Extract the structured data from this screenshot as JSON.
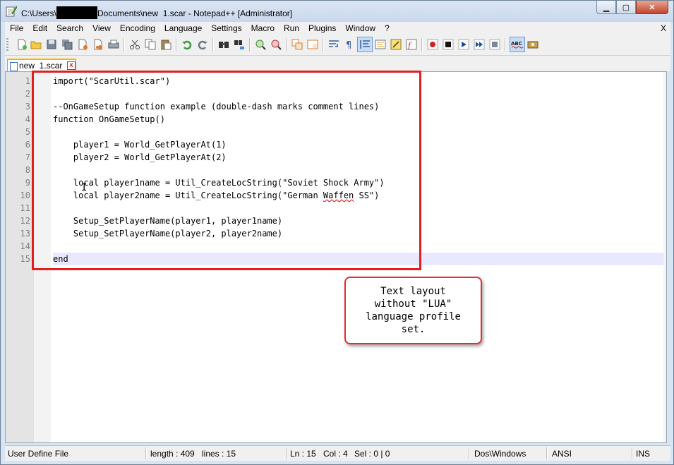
{
  "window": {
    "title_prefix": "C:\\Users\\",
    "title_suffix": "Documents\\new  1.scar - Notepad++ [Administrator]",
    "minimize_glyph": "▁",
    "maximize_glyph": "▢",
    "close_glyph": "✕"
  },
  "menu": {
    "items": [
      "File",
      "Edit",
      "Search",
      "View",
      "Encoding",
      "Language",
      "Settings",
      "Macro",
      "Run",
      "Plugins",
      "Window",
      "?"
    ],
    "close_label": "X"
  },
  "toolbar": {
    "icons": [
      "new-file-icon",
      "open-file-icon",
      "save-icon",
      "save-all-icon",
      "close-icon",
      "close-all-icon",
      "print-icon",
      "cut-icon",
      "copy-icon",
      "paste-icon",
      "undo-icon",
      "redo-icon",
      "find-icon",
      "replace-icon",
      "zoom-in-icon",
      "zoom-out-icon",
      "sync-vertical-icon",
      "sync-horizontal-icon",
      "word-wrap-icon",
      "show-all-chars-icon",
      "indent-guide-icon",
      "user-defined-lang-icon",
      "doc-map-icon",
      "function-list-icon",
      "record-macro-icon",
      "stop-record-icon",
      "play-macro-icon",
      "run-macro-multiple-icon",
      "save-macro-icon",
      "spell-check-icon",
      "settings-icon"
    ]
  },
  "tab": {
    "label": "new  1.scar",
    "close_glyph": "x"
  },
  "editor": {
    "lines": [
      "import(\"ScarUtil.scar\")",
      "",
      "--OnGameSetup function example (double-dash marks comment lines)",
      "function OnGameSetup()",
      "",
      "    player1 = World_GetPlayerAt(1)",
      "    player2 = World_GetPlayerAt(2)",
      "",
      "    local player1name = Util_CreateLocString(\"Soviet Shock Army\")",
      "    local player2name = Util_CreateLocString(\"German Waffen SS\")",
      "",
      "    Setup_SetPlayerName(player1, player1name)",
      "    Setup_SetPlayerName(player2, player2name)",
      "",
      "end"
    ],
    "line_numbers": [
      "1",
      "2",
      "3",
      "4",
      "5",
      "6",
      "7",
      "8",
      "9",
      "10",
      "11",
      "12",
      "13",
      "14",
      "15"
    ],
    "current_line": 15,
    "caret_glyph": "I"
  },
  "annotation": {
    "callout_text": "Text layout\nwithout \"LUA\"\nlanguage profile\nset."
  },
  "status": {
    "lang": "User Define File",
    "length": "length : 409",
    "lines": "lines : 15",
    "ln": "Ln : 15",
    "col": "Col : 4",
    "sel": "Sel : 0 | 0",
    "eol": "Dos\\Windows",
    "encoding": "ANSI",
    "mode": "INS"
  },
  "colors": {
    "annotation_red": "#e02020",
    "current_line_bg": "#e8e8ff",
    "tab_accent": "#f7b500"
  }
}
